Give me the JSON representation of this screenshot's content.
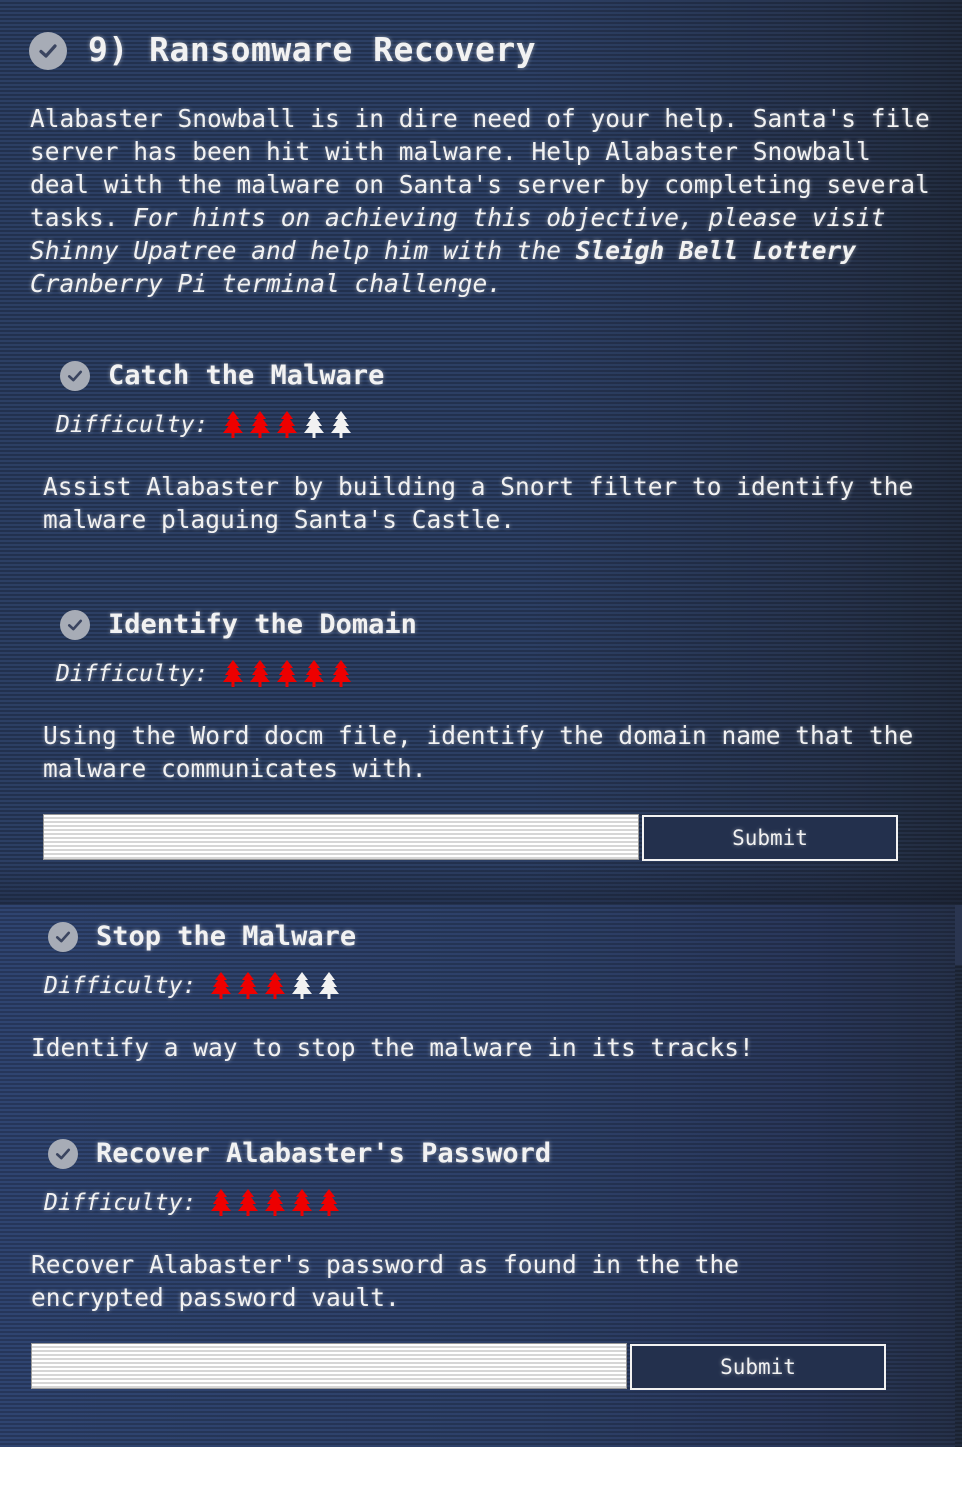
{
  "objective": {
    "number": "9)",
    "title": "Ransomware Recovery",
    "completed": true,
    "intro": {
      "plain": "Alabaster Snowball is in dire need of your help. Santa's file server has been hit with malware. Help Alabaster Snowball deal with the malware on Santa's server by completing several tasks. ",
      "hint_prefix": "For hints on achieving this objective, please visit Shinny Upatree and help him with the ",
      "hint_bold": "Sleigh Bell Lottery",
      "hint_suffix": " Cranberry Pi terminal challenge."
    }
  },
  "difficulty_label": "Difficulty:",
  "colors": {
    "tree_filled": "#ee0000",
    "tree_empty": "#f2f2f2",
    "check_circle": "#a7acb6",
    "check_mark": "#3b4560"
  },
  "tasks": [
    {
      "title": "Catch the Malware",
      "completed": true,
      "difficulty": 3,
      "difficulty_max": 5,
      "description": "Assist Alabaster by building a Snort filter to identify the malware plaguing Santa's Castle.",
      "has_answer": false
    },
    {
      "title": "Identify the Domain",
      "completed": true,
      "difficulty": 5,
      "difficulty_max": 5,
      "description": "Using the Word docm file, identify the domain name that the malware communicates with.",
      "has_answer": true,
      "answer_value": "",
      "submit_label": "Submit"
    },
    {
      "title": "Stop the Malware",
      "completed": true,
      "difficulty": 3,
      "difficulty_max": 5,
      "description": "Identify a way to stop the malware in its tracks!",
      "has_answer": false
    },
    {
      "title": "Recover Alabaster's Password",
      "completed": true,
      "difficulty": 5,
      "difficulty_max": 5,
      "description": "Recover Alabaster's password as found in the the encrypted password vault.",
      "has_answer": true,
      "answer_value": "",
      "submit_label": "Submit"
    }
  ]
}
